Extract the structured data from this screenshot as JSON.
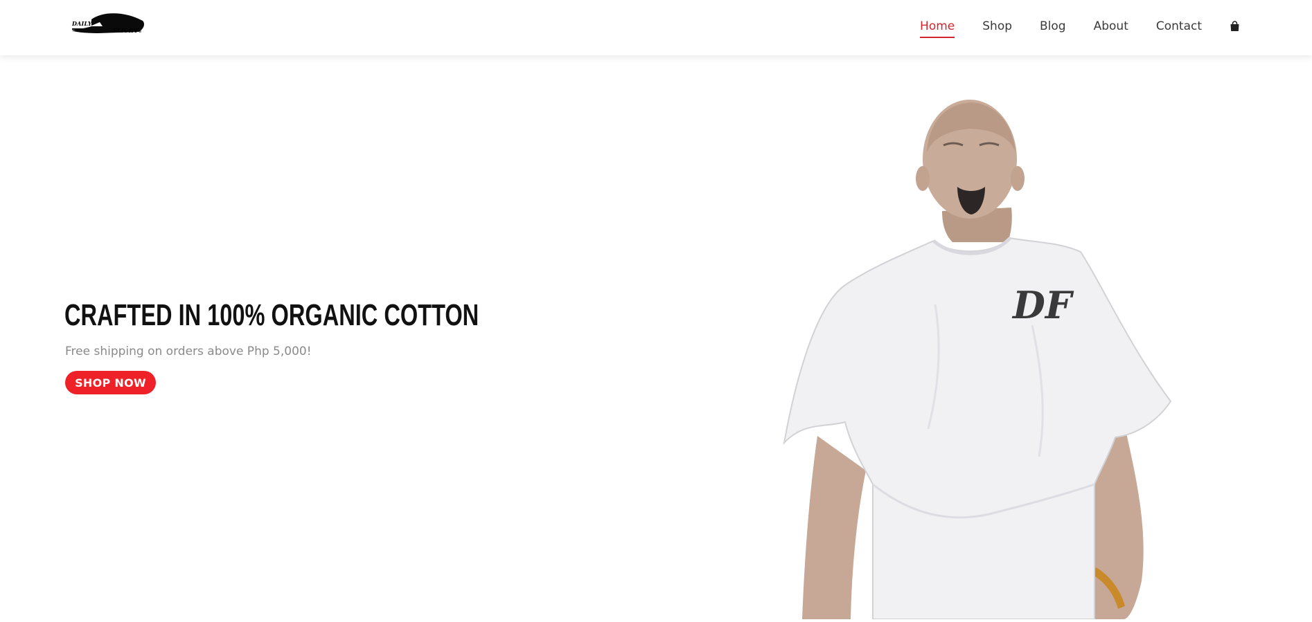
{
  "header": {
    "logo": {
      "line1": "DAILY",
      "line2": "FLIGHT",
      "mark": "®"
    },
    "nav": [
      {
        "label": "Home",
        "active": true
      },
      {
        "label": "Shop",
        "active": false
      },
      {
        "label": "Blog",
        "active": false
      },
      {
        "label": "About",
        "active": false
      },
      {
        "label": "Contact",
        "active": false
      }
    ],
    "cart_icon": "shopping-bag-icon"
  },
  "hero": {
    "title": "CRAFTED IN 100% ORGANIC COTTON",
    "subtitle": "Free shipping on orders above Php 5,000!",
    "cta_label": "SHOP NOW",
    "image": "model-in-white-tshirt",
    "shirt_print": "DF"
  },
  "colors": {
    "accent": "#d1262f",
    "button": "#ee2128",
    "title": "#111111",
    "subtitle": "#8a8a8a",
    "nav_text": "#3a3a3a"
  }
}
